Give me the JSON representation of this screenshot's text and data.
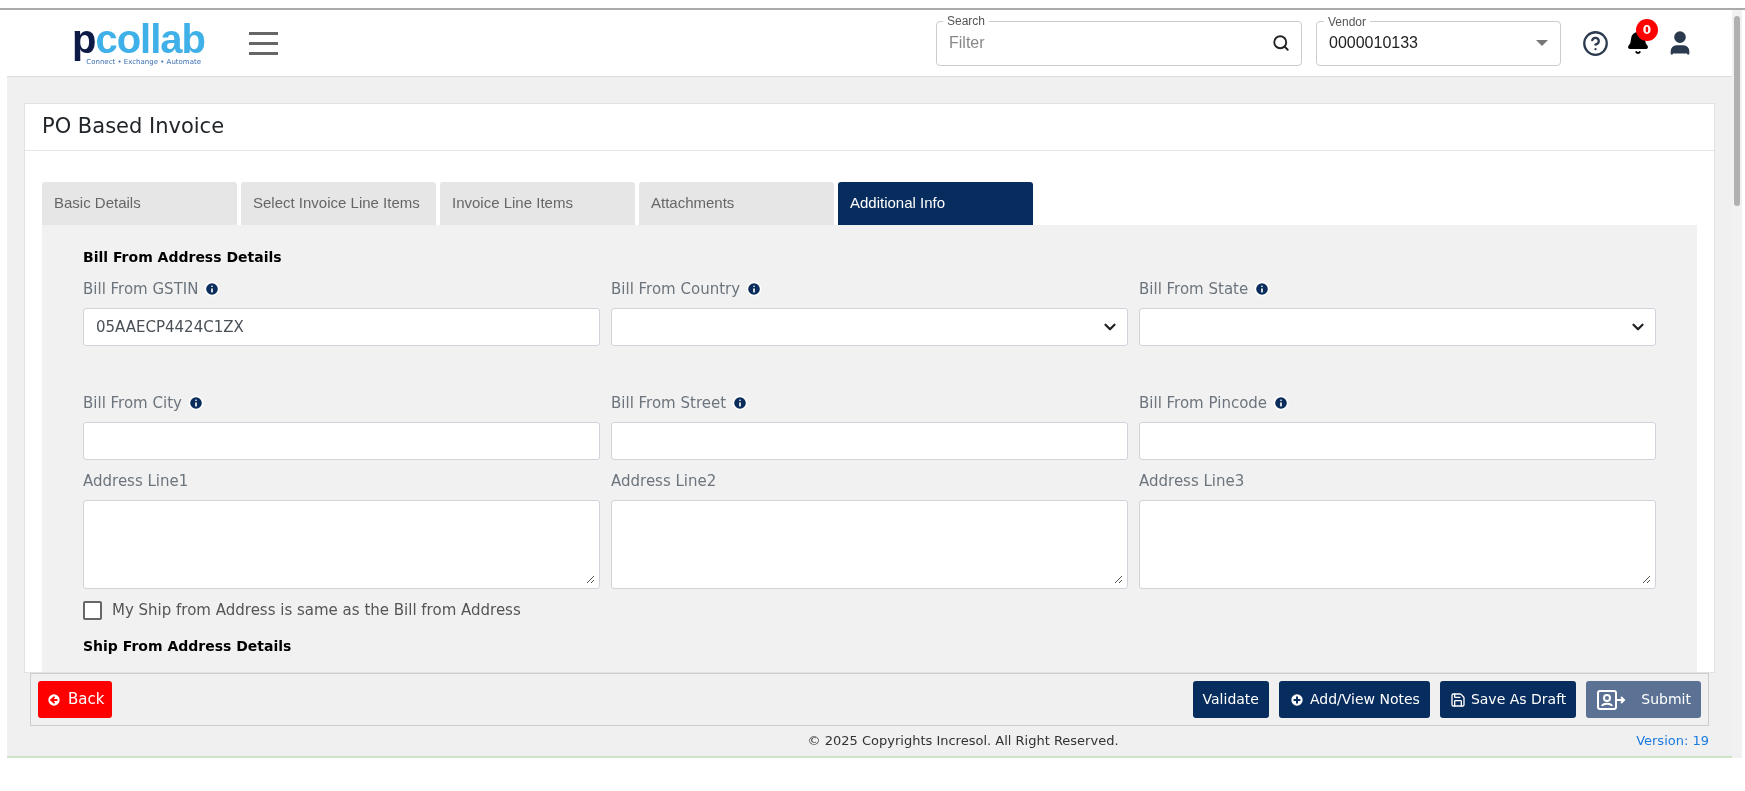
{
  "header": {
    "logo": {
      "mark": "p",
      "name": "collab",
      "tagline": "Connect • Exchange • Automate"
    },
    "search": {
      "label": "Search",
      "placeholder": "Filter"
    },
    "vendor": {
      "label": "Vendor",
      "value": "0000010133"
    },
    "notifications": {
      "count": "0"
    }
  },
  "page": {
    "title": "PO Based Invoice"
  },
  "tabs": [
    {
      "label": "Basic Details",
      "selected": false
    },
    {
      "label": "Select Invoice Line Items",
      "selected": false
    },
    {
      "label": "Invoice Line Items",
      "selected": false
    },
    {
      "label": "Attachments",
      "selected": false
    },
    {
      "label": "Additional Info",
      "selected": true
    }
  ],
  "bill_from": {
    "heading": "Bill From Address Details",
    "fields": [
      {
        "label": "Bill From GSTIN",
        "kind": "text",
        "info": true,
        "value": "05AAECP4424C1ZX"
      },
      {
        "label": "Bill From Country",
        "kind": "select",
        "info": true
      },
      {
        "label": "Bill From State",
        "kind": "select",
        "info": true
      },
      {
        "label": "Bill From City",
        "kind": "text",
        "info": true
      },
      {
        "label": "Bill From Street",
        "kind": "text",
        "info": true
      },
      {
        "label": "Bill From Pincode",
        "kind": "text",
        "info": true
      },
      {
        "label": "Address Line1",
        "kind": "textarea",
        "info": false
      },
      {
        "label": "Address Line2",
        "kind": "textarea",
        "info": false
      },
      {
        "label": "Address Line3",
        "kind": "textarea",
        "info": false
      }
    ]
  },
  "same_address": {
    "label": "My Ship from Address is same as the Bill from Address",
    "checked": false
  },
  "ship_from": {
    "heading": "Ship From Address Details"
  },
  "actions": {
    "back": "Back",
    "buttons": [
      {
        "label": "Validate",
        "kind": "plain",
        "disabled": false
      },
      {
        "label": "Add/View Notes",
        "kind": "notes",
        "disabled": false
      },
      {
        "label": "Save As Draft",
        "kind": "save",
        "disabled": false
      },
      {
        "label": "Submit",
        "kind": "submit",
        "disabled": true
      }
    ]
  },
  "footer": {
    "copyright": "© 2025 Copyrights Incresol. All Right Reserved.",
    "version": "Version: 19"
  }
}
